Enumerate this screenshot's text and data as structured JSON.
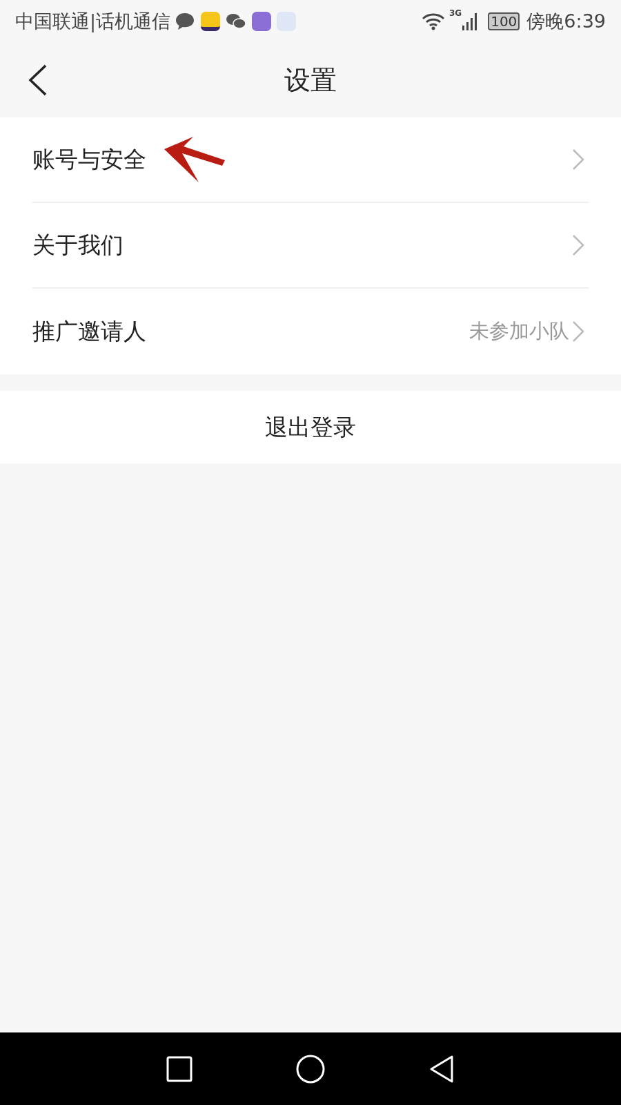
{
  "status_bar": {
    "carrier": "中国联通|话机通信",
    "network": "3G",
    "battery": "100",
    "time": "傍晚6:39"
  },
  "header": {
    "title": "设置"
  },
  "settings_items": [
    {
      "label": "账号与安全",
      "annotated": true
    },
    {
      "label": "关于我们",
      "annotated": false
    },
    {
      "label": "推广邀请人",
      "value": "未参加小队",
      "annotated": false
    }
  ],
  "logout_button": {
    "label": "退出登录"
  }
}
